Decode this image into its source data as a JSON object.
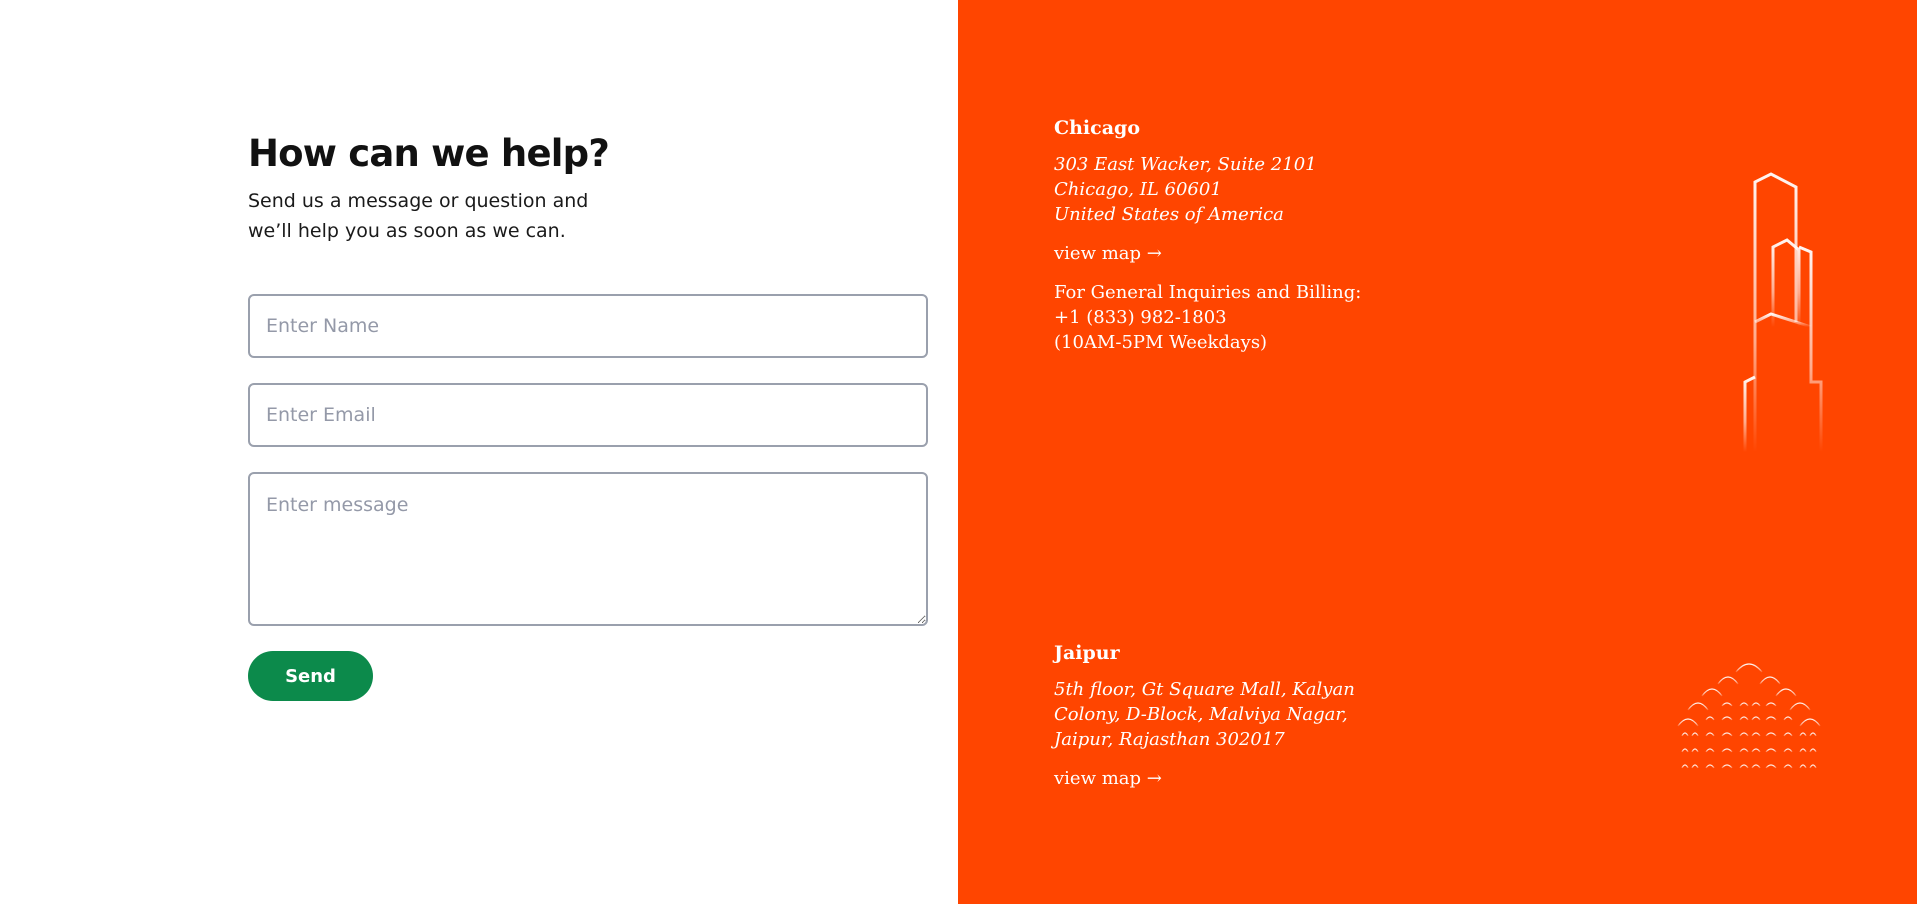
{
  "form": {
    "heading": "How can we help?",
    "subtext": "Send us a message or question and we’ll help you as soon as we can.",
    "name_placeholder": "Enter Name",
    "email_placeholder": "Enter Email",
    "message_placeholder": "Enter message",
    "send_label": "Send"
  },
  "locations": {
    "chicago": {
      "city": "Chicago",
      "address": [
        "303 East Wacker, Suite 2101",
        "Chicago, IL 60601",
        "United States of America"
      ],
      "map_link": "view map →",
      "contact": [
        "For General Inquiries and Billing:",
        "+1 (833) 982-1803",
        "(10AM-5PM Weekdays)"
      ],
      "illustration_icon": "skyscraper-icon"
    },
    "jaipur": {
      "city": "Jaipur",
      "address": "5th floor, Gt Square Mall, Kalyan Colony, D-Block, Malviya Nagar, Jaipur, Rajasthan 302017",
      "map_link": "view map →",
      "illustration_icon": "palace-icon"
    }
  },
  "colors": {
    "accent": "#ff4500",
    "send_button": "#0c8a4b",
    "field_border": "#9aa0ad"
  }
}
